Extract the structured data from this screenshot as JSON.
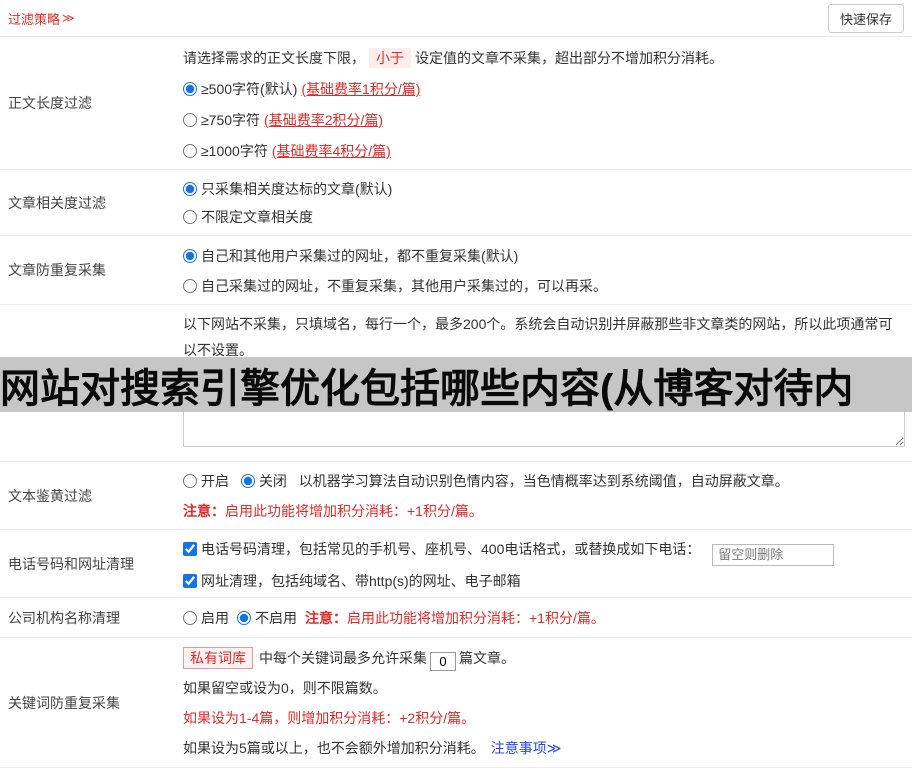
{
  "header": {
    "title": "过滤策略",
    "title_arrow": "≫",
    "save_button": "快速保存"
  },
  "length_filter": {
    "label": "正文长度过滤",
    "intro_before": "请选择需求的正文长度下限，",
    "intro_tag": "小于",
    "intro_after": "设定值的文章不采集，超出部分不增加积分消耗。",
    "options": [
      {
        "text": "≥500字符(默认)",
        "fee": "(基础费率1积分/篇)",
        "checked": true
      },
      {
        "text": "≥750字符",
        "fee": "(基础费率2积分/篇)",
        "checked": false
      },
      {
        "text": "≥1000字符",
        "fee": "(基础费率4积分/篇)",
        "checked": false
      }
    ]
  },
  "relevance_filter": {
    "label": "文章相关度过滤",
    "options": [
      {
        "text": "只采集相关度达标的文章(默认)",
        "checked": true
      },
      {
        "text": "不限定文章相关度",
        "checked": false
      }
    ]
  },
  "dedup_filter": {
    "label": "文章防重复采集",
    "options": [
      {
        "text": "自己和其他用户采集过的网址，都不重复采集(默认)",
        "checked": true
      },
      {
        "text": "自己采集过的网址，不重复采集，其他用户采集过的，可以再采。",
        "checked": false
      }
    ]
  },
  "site_blacklist": {
    "description": "以下网站不采集，只填域名，每行一个，最多200个。系统会自动识别并屏蔽那些非文章类的网站，所以此项通常可以不设置。"
  },
  "ad_overlay": {
    "text": "网站对搜索引擎优化包括哪些内容(从博客对待内"
  },
  "porn_filter": {
    "label": "文本鉴黄过滤",
    "option_on": "开启",
    "option_off": "关闭",
    "description": "以机器学习算法自动识别色情内容，当色情概率达到系统阈值，自动屏蔽文章。",
    "note_head": "注意：",
    "note_body": "启用此功能将增加积分消耗：+1积分/篇。"
  },
  "phone_url_clean": {
    "label": "电话号码和网址清理",
    "phone_text": "电话号码清理，包括常见的手机号、座机号、400电话格式，或替换成如下电话：",
    "phone_placeholder": "留空则删除",
    "url_text": "网址清理，包括纯域名、带http(s)的网址、电子邮箱"
  },
  "company_clean": {
    "label": "公司机构名称清理",
    "option_on": "启用",
    "option_off": "不启用",
    "note_head": "注意：",
    "note_body": "启用此功能将增加积分消耗：+1积分/篇。"
  },
  "keyword_dedup": {
    "label": "关键词防重复采集",
    "tag": "私有词库",
    "line1_mid": "中每个关键词最多允许采集",
    "count_value": "0",
    "line1_end": "篇文章。",
    "line2": "如果留空或设为0，则不限篇数。",
    "line3": "如果设为1-4篇，则增加积分消耗：+2积分/篇。",
    "line4": "如果设为5篇或以上，也不会额外增加积分消耗。",
    "link": "注意事项≫"
  }
}
